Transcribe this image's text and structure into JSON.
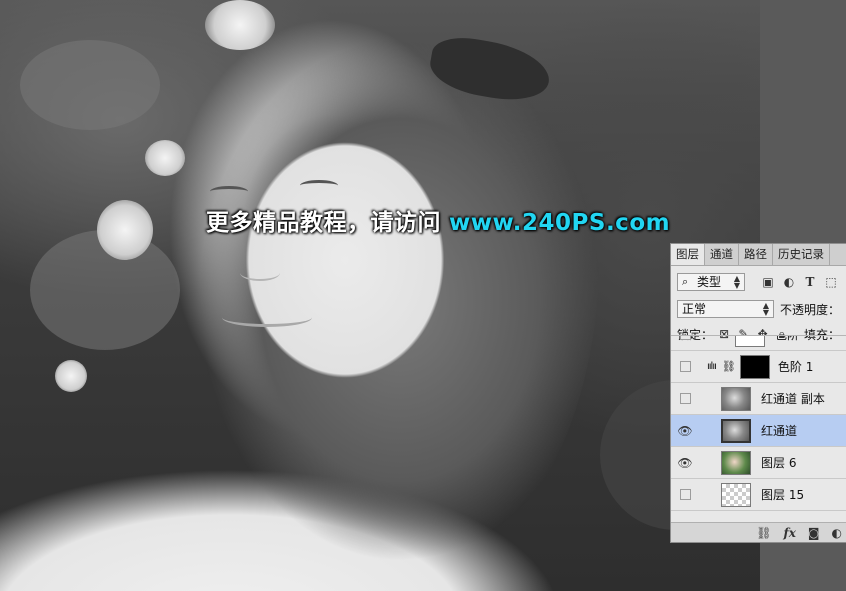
{
  "watermark": {
    "chinese": "更多精品教程，请访问",
    "url": "www.240PS.com"
  },
  "layers_panel": {
    "tabs": [
      {
        "label": "图层",
        "active": true
      },
      {
        "label": "通道",
        "active": false
      },
      {
        "label": "路径",
        "active": false
      },
      {
        "label": "历史记录",
        "active": false
      }
    ],
    "filter": {
      "icon": "search-icon",
      "value": "类型"
    },
    "blend_mode": "正常",
    "opacity_label": "不透明度：",
    "lock_label": "锁定：",
    "fill_label": "填充：",
    "layers": [
      {
        "name": "色阶",
        "visible": false,
        "thumb": "white"
      },
      {
        "name": "色阶 1",
        "visible": false,
        "thumb": "black",
        "adjustment_icon": "levels-icon"
      },
      {
        "name": "红通道 副本",
        "visible": false,
        "thumb": "gray"
      },
      {
        "name": "红通道",
        "visible": true,
        "thumb": "gray",
        "selected": true
      },
      {
        "name": "图层 6",
        "visible": true,
        "thumb": "color"
      },
      {
        "name": "图层 15",
        "visible": false,
        "thumb": "trans"
      }
    ],
    "bottom_icons": [
      "link-icon",
      "fx-icon",
      "mask-icon",
      "adjustment-icon"
    ],
    "fx_label": "fx"
  }
}
